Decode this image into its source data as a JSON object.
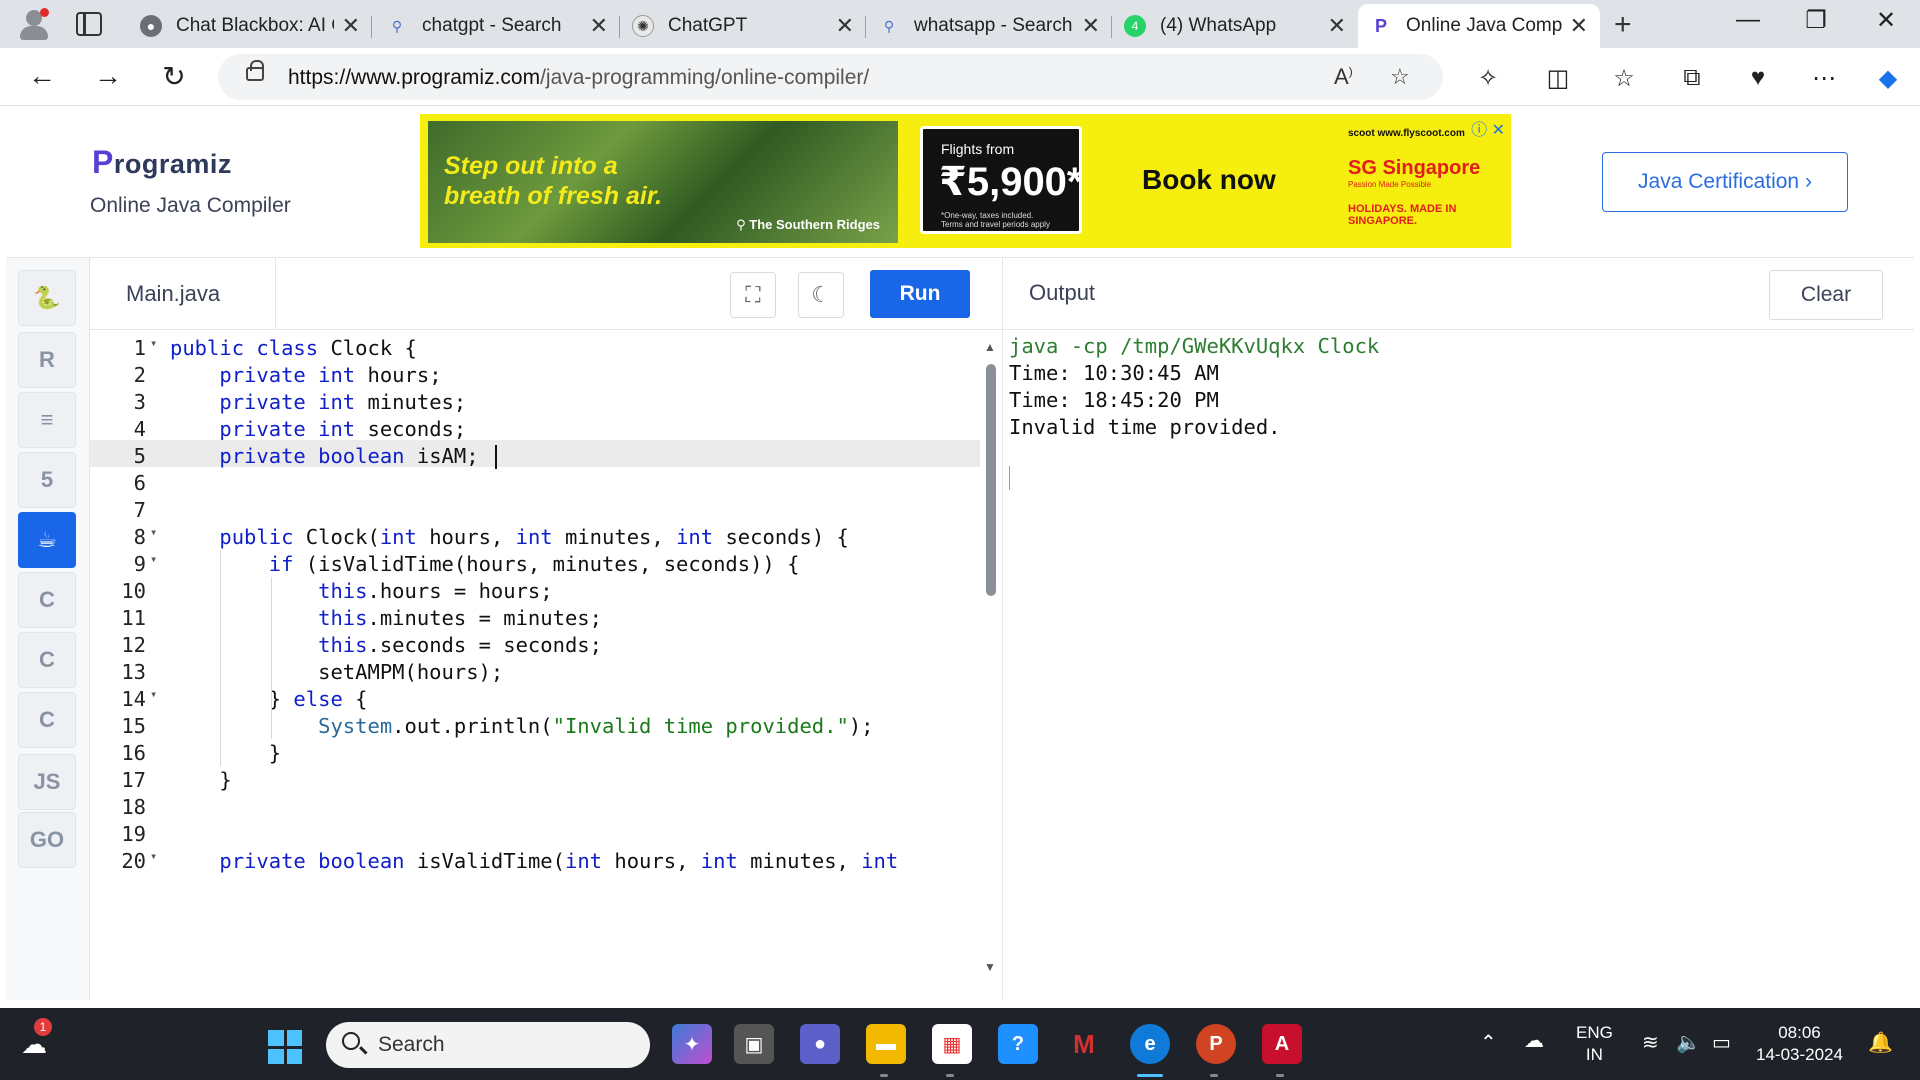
{
  "browser": {
    "tabs": [
      {
        "title": "Chat Blackbox: AI C",
        "icon": "blackbox-icon"
      },
      {
        "title": "chatgpt - Search",
        "icon": "search-icon"
      },
      {
        "title": "ChatGPT",
        "icon": "chatgpt-icon"
      },
      {
        "title": "whatsapp - Search",
        "icon": "search-icon"
      },
      {
        "title": "(4) WhatsApp",
        "icon": "whatsapp-icon"
      },
      {
        "title": "Online Java Compi",
        "icon": "programiz-icon",
        "active": true
      }
    ],
    "url_domain": "https://www.programiz.com",
    "url_path": "/java-programming/online-compiler/"
  },
  "header": {
    "logo": "rogramiz",
    "logo_initial": "P",
    "subtitle": "Online Java Compiler",
    "ad": {
      "headline_line1": "Step out into a",
      "headline_line2": "breath of fresh air.",
      "location": "The Southern Ridges",
      "flights_from": "Flights from",
      "price": "₹5,900*",
      "fine1": "*One-way, taxes included.",
      "fine2": "Terms and travel periods apply",
      "cta": "Book now",
      "scoot": "scoot  www.flyscoot.com",
      "sg": "SG Singapore",
      "sg_tag": "Passion Made Possible",
      "holidays": "HOLIDAYS. MADE IN SINGAPORE."
    },
    "cert_button": "Java Certification ›"
  },
  "editor": {
    "filename": "Main.java",
    "run_label": "Run",
    "lines": [
      {
        "n": "1",
        "fold": true,
        "html": "<span class='kw'>public</span> <span class='kw'>class</span> Clock {"
      },
      {
        "n": "2",
        "html": "    <span class='kw'>private</span> <span class='kw'>int</span> hours;"
      },
      {
        "n": "3",
        "html": "    <span class='kw'>private</span> <span class='kw'>int</span> minutes;"
      },
      {
        "n": "4",
        "html": "    <span class='kw'>private</span> <span class='kw'>int</span> seconds;"
      },
      {
        "n": "5",
        "cur": true,
        "html": "    <span class='kw'>private</span> <span class='kw'>boolean</span> isAM; <span class='caret'></span>"
      },
      {
        "n": "6",
        "html": ""
      },
      {
        "n": "7",
        "html": ""
      },
      {
        "n": "8",
        "fold": true,
        "html": "    <span class='kw'>public</span> Clock(<span class='kw'>int</span> hours, <span class='kw'>int</span> minutes, <span class='kw'>int</span> seconds) {"
      },
      {
        "n": "9",
        "fold": true,
        "html": "        <span class='kw'>if</span> (isValidTime(hours, minutes, seconds)) {"
      },
      {
        "n": "10",
        "html": "            <span class='kw'>this</span>.hours = hours;"
      },
      {
        "n": "11",
        "html": "            <span class='kw'>this</span>.minutes = minutes;"
      },
      {
        "n": "12",
        "html": "            <span class='kw'>this</span>.seconds = seconds;"
      },
      {
        "n": "13",
        "html": "            setAMPM(hours);"
      },
      {
        "n": "14",
        "fold": true,
        "html": "        } <span class='kw'>else</span> {"
      },
      {
        "n": "15",
        "html": "            <span class='sys'>System</span>.out.println(<span class='str'>\"Invalid time provided.\"</span>);"
      },
      {
        "n": "16",
        "html": "        }"
      },
      {
        "n": "17",
        "html": "    }"
      },
      {
        "n": "18",
        "html": ""
      },
      {
        "n": "19",
        "html": ""
      },
      {
        "n": "20",
        "fold": true,
        "html": "    <span class='kw'>private</span> <span class='kw'>boolean</span> isValidTime(<span class='kw'>int</span> hours, <span class='kw'>int</span> minutes, <span class='kw'>int</span>"
      }
    ]
  },
  "output": {
    "title": "Output",
    "clear_label": "Clear",
    "lines": [
      {
        "text": "java -cp /tmp/GWeKKvUqkx Clock",
        "cmd": true
      },
      {
        "text": "Time: 10:30:45 AM"
      },
      {
        "text": "Time: 18:45:20 PM"
      },
      {
        "text": "Invalid time provided."
      }
    ]
  },
  "languages": [
    {
      "name": "python-icon",
      "glyph": "🐍"
    },
    {
      "name": "r-icon",
      "glyph": "R"
    },
    {
      "name": "sql-icon",
      "glyph": "≡"
    },
    {
      "name": "html5-icon",
      "glyph": "5"
    },
    {
      "name": "java-icon",
      "glyph": "☕",
      "active": true
    },
    {
      "name": "c-icon",
      "glyph": "C"
    },
    {
      "name": "csharp-icon",
      "glyph": "C"
    },
    {
      "name": "cpp-icon",
      "glyph": "C"
    },
    {
      "name": "js-icon",
      "glyph": "JS"
    },
    {
      "name": "go-icon",
      "glyph": "GO"
    }
  ],
  "taskbar": {
    "search": "Search",
    "lang_top": "ENG",
    "lang_bottom": "IN",
    "time": "08:06",
    "date": "14-03-2024",
    "weather_badge": "1",
    "colors": {
      "bg": "#1f2329",
      "accent": "#4cc2ff"
    }
  }
}
